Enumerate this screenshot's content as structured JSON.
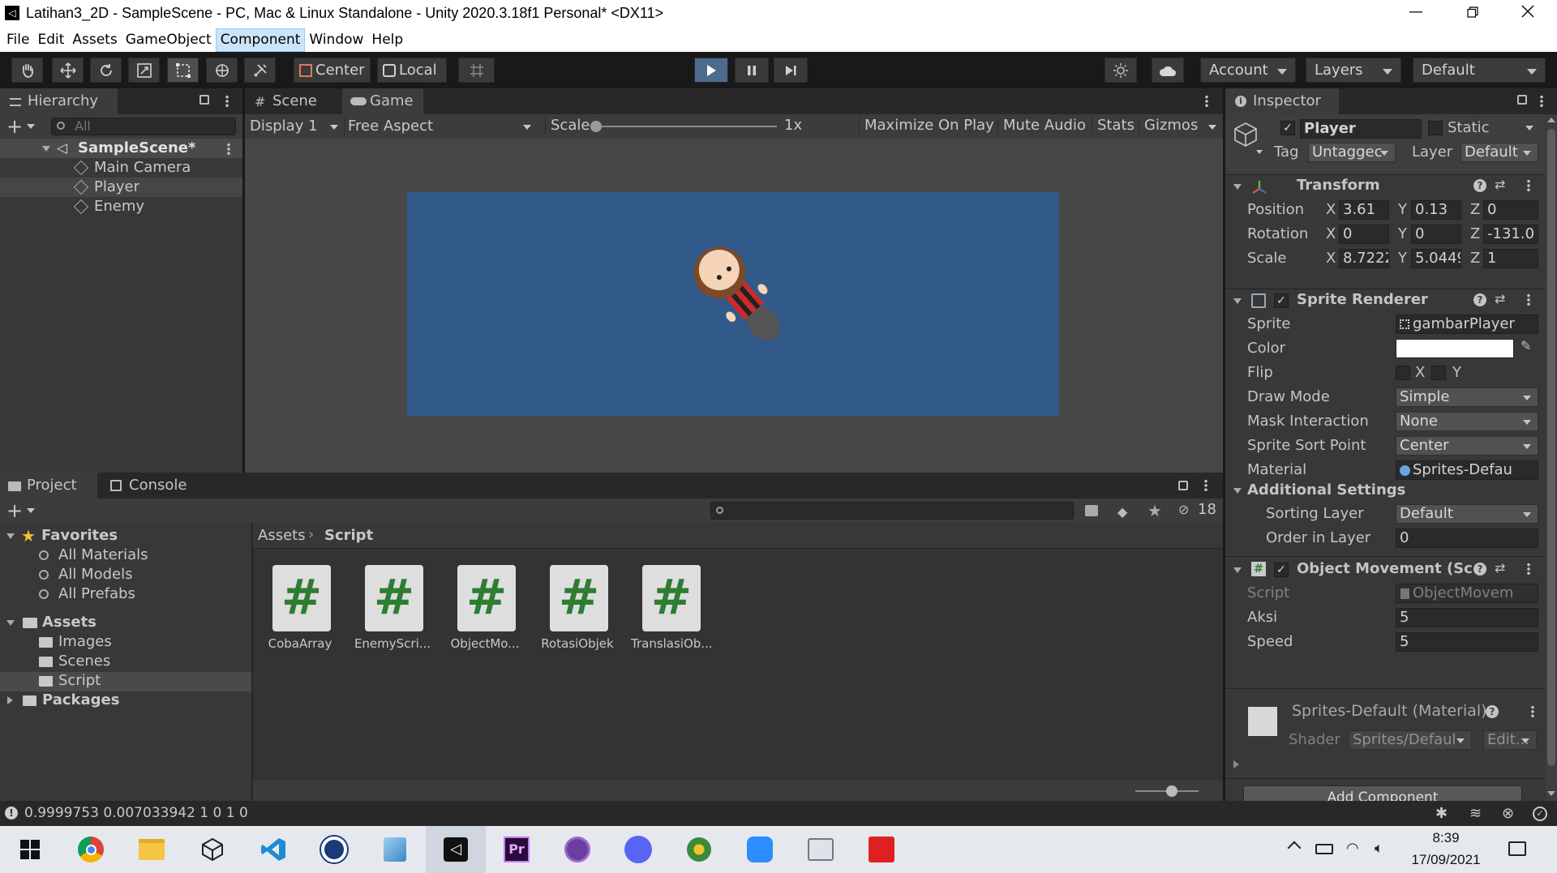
{
  "window": {
    "title": "Latihan3_2D - SampleScene - PC, Mac & Linux Standalone - Unity 2020.3.18f1 Personal* <DX11>"
  },
  "menu": [
    "File",
    "Edit",
    "Assets",
    "GameObject",
    "Component",
    "Window",
    "Help"
  ],
  "toolbar": {
    "pivot": "Center",
    "space": "Local",
    "account": "Account",
    "layers": "Layers",
    "layout": "Default"
  },
  "hierarchy": {
    "tab": "Hierarchy",
    "search_placeholder": "All",
    "scene": "SampleScene*",
    "items": [
      "Main Camera",
      "Player",
      "Enemy"
    ]
  },
  "view": {
    "scene_tab": "Scene",
    "game_tab": "Game",
    "display": "Display 1",
    "aspect": "Free Aspect",
    "scale_label": "Scale",
    "scale_value": "1x",
    "maximize": "Maximize On Play",
    "mute": "Mute Audio",
    "stats": "Stats",
    "gizmos": "Gizmos",
    "bg_color": "#315a8a"
  },
  "project": {
    "tab_project": "Project",
    "tab_console": "Console",
    "favorites": "Favorites",
    "fav_items": [
      "All Materials",
      "All Models",
      "All Prefabs"
    ],
    "assets": "Assets",
    "asset_folders": [
      "Images",
      "Scenes",
      "Script"
    ],
    "packages": "Packages",
    "breadcrumb_root": "Assets",
    "breadcrumb_current": "Script",
    "hidden_count": "18",
    "files": [
      "CobaArray",
      "EnemyScri...",
      "ObjectMo...",
      "RotasiObjek",
      "TranslasiOb..."
    ]
  },
  "inspector": {
    "tab": "Inspector",
    "name": "Player",
    "static": "Static",
    "tag_label": "Tag",
    "tag": "Untaggec",
    "layer_label": "Layer",
    "layer": "Default",
    "transform": {
      "title": "Transform",
      "position_label": "Position",
      "rotation_label": "Rotation",
      "scale_label": "Scale",
      "pos": [
        "3.61",
        "0.13",
        "0"
      ],
      "rot": [
        "0",
        "0",
        "-131.0"
      ],
      "scl": [
        "8.7222",
        "5.0449",
        "1"
      ],
      "x": "X",
      "y": "Y",
      "z": "Z"
    },
    "sprite_renderer": {
      "title": "Sprite Renderer",
      "sprite_label": "Sprite",
      "sprite": "gambarPlayer",
      "color_label": "Color",
      "flip_label": "Flip",
      "flip_x": "X",
      "flip_y": "Y",
      "draw_mode_label": "Draw Mode",
      "draw_mode": "Simple",
      "mask_label": "Mask Interaction",
      "mask": "None",
      "sort_point_label": "Sprite Sort Point",
      "sort_point": "Center",
      "material_label": "Material",
      "material": "Sprites-Defau",
      "additional": "Additional Settings",
      "sorting_layer_label": "Sorting Layer",
      "sorting_layer": "Default",
      "order_label": "Order in Layer",
      "order": "0"
    },
    "object_movement": {
      "title": "Object Movement (Sc",
      "script_label": "Script",
      "script": "ObjectMovem",
      "aksi_label": "Aksi",
      "aksi": "5",
      "speed_label": "Speed",
      "speed": "5"
    },
    "material": {
      "title": "Sprites-Default (Material)",
      "shader_label": "Shader",
      "shader": "Sprites/Defaul",
      "edit": "Edit..."
    },
    "add_component": "Add Component"
  },
  "status": {
    "text": "0.9999753 0.007033942 1 0 1 0"
  },
  "taskbar": {
    "time": "8:39",
    "date": "17/09/2021"
  }
}
